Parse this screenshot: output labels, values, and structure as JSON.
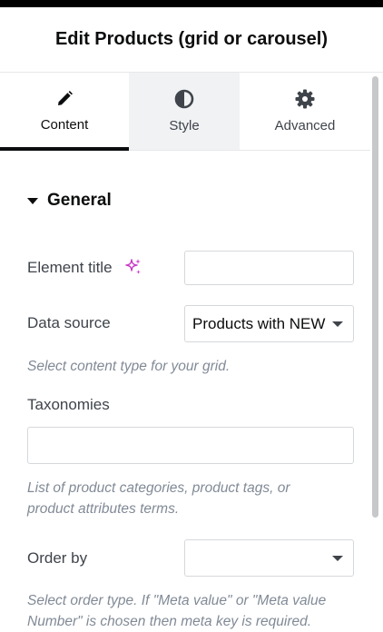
{
  "header": {
    "title": "Edit Products (grid or carousel)"
  },
  "tabs": [
    {
      "label": "Content",
      "icon": "pencil-icon"
    },
    {
      "label": "Style",
      "icon": "contrast-icon"
    },
    {
      "label": "Advanced",
      "icon": "gear-icon"
    }
  ],
  "section": {
    "title": "General"
  },
  "fields": {
    "element_title": {
      "label": "Element title",
      "value": "",
      "ai_icon": "sparkle-icon"
    },
    "data_source": {
      "label": "Data source",
      "value": "Products with NEW",
      "help": "Select content type for your grid."
    },
    "taxonomies": {
      "label": "Taxonomies",
      "value": "",
      "help_line1": "List of product categories, product tags, or",
      "help_line2": "product attributes terms."
    },
    "order_by": {
      "label": "Order by",
      "value": "",
      "help_line1": "Select order type. If \"Meta value\" or \"Meta value",
      "help_line2": "Number\" is chosen then meta key is required."
    }
  },
  "colors": {
    "accent_ai": "#c837c8",
    "text": "#3f444b",
    "help": "#818a96",
    "active_tab_bar": "#0c0d0e"
  }
}
